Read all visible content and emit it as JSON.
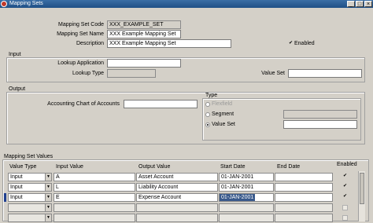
{
  "window": {
    "title": "Mapping Sets",
    "min_glyph": "_",
    "max_glyph": "□",
    "close_glyph": "×"
  },
  "header": {
    "code_label": "Mapping Set Code",
    "code_value": "XXX_EXAMPLE_SET",
    "name_label": "Mapping Set Name",
    "name_value": "XXX Example Mapping Set",
    "desc_label": "Description",
    "desc_value": "XXX Example Mapping Set",
    "enabled_label": "Enabled",
    "enabled_checked": true
  },
  "input": {
    "section_label": "Input",
    "lookup_app_label": "Lookup Application",
    "lookup_app_value": "",
    "lookup_type_label": "Lookup Type",
    "lookup_type_value": "",
    "value_set_label": "Value Set",
    "value_set_value": ""
  },
  "output": {
    "section_label": "Output",
    "coa_label": "Accounting Chart of Accounts",
    "coa_value": "",
    "type_label": "Type",
    "type_options": [
      "Flexfield",
      "Segment",
      "Value Set"
    ],
    "type_selected": "Value Set"
  },
  "values": {
    "section_label": "Mapping Set Values",
    "columns": {
      "value_type": "Value Type",
      "input_value": "Input Value",
      "output_value": "Output Value",
      "start_date": "Start Date",
      "end_date": "End Date",
      "enabled": "Enabled"
    },
    "rows": [
      {
        "value_type": "Input",
        "input_value": "A",
        "output_value": "Asset Account",
        "start_date": "01-JAN-2001",
        "end_date": "",
        "enabled": true
      },
      {
        "value_type": "Input",
        "input_value": "L",
        "output_value": "Liability Account",
        "start_date": "01-JAN-2001",
        "end_date": "",
        "enabled": true
      },
      {
        "value_type": "Input",
        "input_value": "E",
        "output_value": "Expense Account",
        "start_date": "01-JAN-2001",
        "end_date": "",
        "enabled": true
      }
    ],
    "check_glyph": "✔",
    "arrow_glyph": "▼"
  }
}
